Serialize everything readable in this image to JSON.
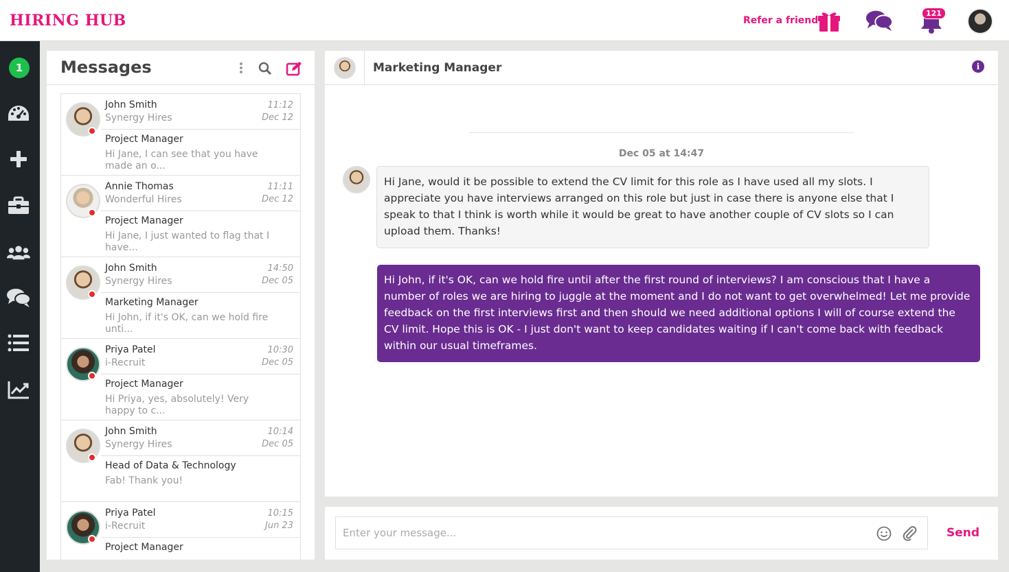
{
  "app": {
    "logo": "HIRING HUB",
    "refer_label": "Refer a friend",
    "notification_count": "121",
    "brand_color": "#e5177d",
    "accent_color": "#6a2c91"
  },
  "sidebar": {
    "count_badge": "1",
    "items": [
      {
        "icon": "dashboard-icon"
      },
      {
        "icon": "plus-icon"
      },
      {
        "icon": "briefcase-icon"
      },
      {
        "icon": "users-icon"
      },
      {
        "icon": "chat-icon"
      },
      {
        "icon": "list-icon"
      },
      {
        "icon": "chart-icon"
      }
    ]
  },
  "messages": {
    "title": "Messages",
    "conversations": [
      {
        "name": "John Smith",
        "company": "Synergy Hires",
        "time": "11:12",
        "date": "Dec 12",
        "role": "Project Manager",
        "preview": "Hi Jane, I can see that you have made an o..."
      },
      {
        "name": "Annie Thomas",
        "company": "Wonderful Hires",
        "time": "11:11",
        "date": "Dec 12",
        "role": "Project Manager",
        "preview": "Hi Jane, I just wanted to flag that I have..."
      },
      {
        "name": "John Smith",
        "company": "Synergy Hires",
        "time": "14:50",
        "date": "Dec 05",
        "role": "Marketing Manager",
        "preview": "Hi John, if it's OK, can we hold fire unti..."
      },
      {
        "name": "Priya Patel",
        "company": "i-Recruit",
        "time": "10:30",
        "date": "Dec 05",
        "role": "Project Manager",
        "preview": "Hi Priya, yes, absolutely! Very happy to c..."
      },
      {
        "name": "John Smith",
        "company": "Synergy Hires",
        "time": "10:14",
        "date": "Dec 05",
        "role": "Head of Data & Technology",
        "preview": "Fab! Thank you!"
      },
      {
        "name": "Priya Patel",
        "company": "i-Recruit",
        "time": "10:15",
        "date": "Jun 23",
        "role": "Project Manager",
        "preview": ""
      }
    ]
  },
  "chat": {
    "title": "Marketing Manager",
    "day_label": "Dec 05 at 14:47",
    "incoming": "Hi Jane, would it be possible to extend the CV limit for this role as I have used all my slots. I appreciate you have interviews arranged on this role but just in case there is anyone else that I speak to that I think is worth while it would be great to have another couple of CV slots so I can upload them. Thanks!",
    "outgoing": "Hi John, if it's OK, can we hold fire until after the first round of interviews? I am conscious that I have a number of roles we are hiring to juggle at the moment and I do not want to get overwhelmed! Let me provide feedback on the first interviews first and then should we need additional options I will of course extend the CV limit. Hope this is OK - I just don't want to keep candidates waiting if I can't come back with feedback within our usual timeframes."
  },
  "composer": {
    "placeholder": "Enter your message...",
    "send_label": "Send"
  }
}
